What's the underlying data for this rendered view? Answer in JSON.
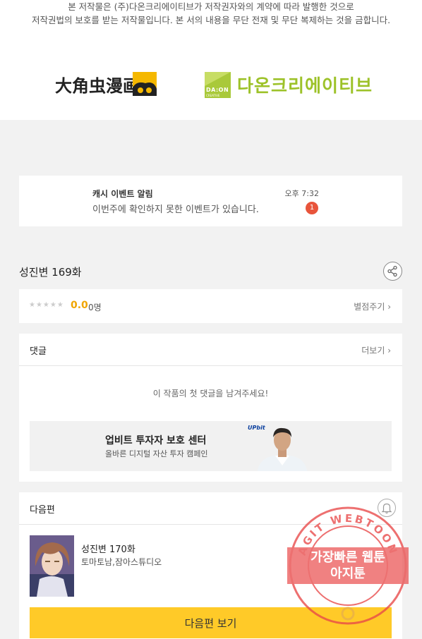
{
  "copyright": {
    "line1": "본 저작물은 (주)다온크리에이티브가 저작권자와의 계약에 따라 발행한 것으로",
    "line2": "저작권법의 보호를 받는 저작물입니다. 본 서의 내용을 무단 전재 및 무단 복제하는 것을 금합니다."
  },
  "logos": {
    "publisher": "大角虫漫画",
    "daon_mark_line1": "DA:ON",
    "daon_mark_line2": "CREATIVE",
    "daon_name": "다온크리에이티브"
  },
  "notification": {
    "title": "캐시 이벤트 알림",
    "message": "이번주에 확인하지 못한 이벤트가 있습니다.",
    "time": "오후 7:32",
    "badge": "1"
  },
  "episode": {
    "title": "성진변 169화"
  },
  "rating": {
    "stars": "★★★★★",
    "score": "0.0",
    "count": "0명",
    "rate_link": "별점주기 ›"
  },
  "comments": {
    "title": "댓글",
    "more": "더보기 ›",
    "empty": "이 작품의 첫 댓글을 남겨주세요!"
  },
  "ad": {
    "title": "업비트 투자자 보호 센터",
    "subtitle": "올바른 디지털 자산 투자 캠페인",
    "brand": "UPbit"
  },
  "next": {
    "title": "다음편",
    "episode_title": "성진변 170화",
    "author": "토마토남,잠아스튜디오",
    "button": "다음편 보기"
  },
  "watermark": {
    "ring_text": "AGIT WEBTOON",
    "line1": "가장빠른 웹툰",
    "line2": "아지툰"
  },
  "colors": {
    "accent_yellow": "#ffca28",
    "rating_orange": "#f0a500",
    "badge_red": "#e8543b",
    "daon_green": "#9dc229",
    "watermark_red": "#e84848"
  }
}
